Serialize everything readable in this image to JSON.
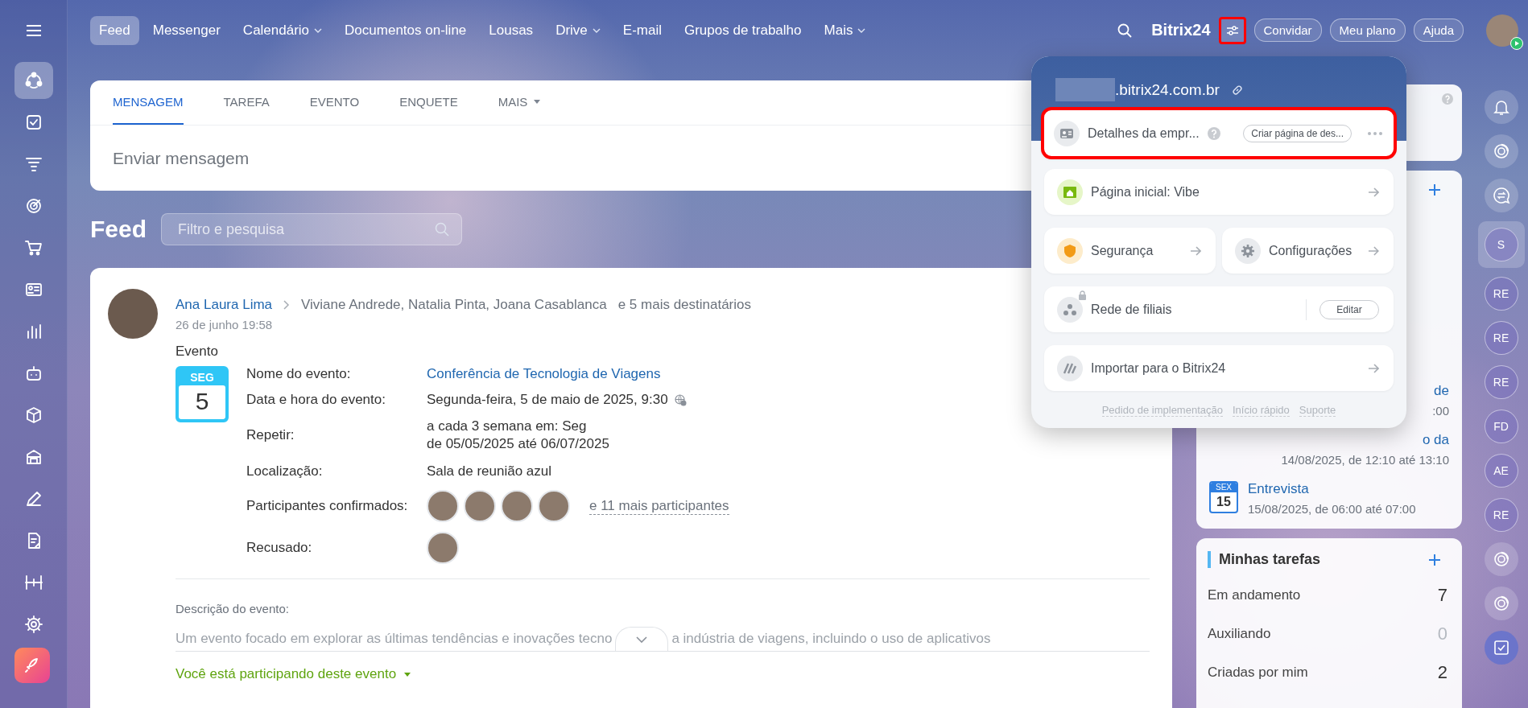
{
  "sidebar": {
    "items": [
      {
        "selected": true
      },
      {
        "selected": false
      },
      {
        "selected": false
      },
      {
        "selected": false
      },
      {
        "selected": false
      },
      {
        "selected": false
      },
      {
        "selected": false
      },
      {
        "selected": false
      },
      {
        "selected": false
      },
      {
        "selected": false
      },
      {
        "selected": false
      },
      {
        "selected": false
      },
      {
        "selected": false
      },
      {
        "selected": false
      },
      {
        "selected": false
      }
    ]
  },
  "topbar": {
    "nav": [
      {
        "label": "Feed",
        "selected": true,
        "dropdown": false
      },
      {
        "label": "Messenger",
        "selected": false,
        "dropdown": false
      },
      {
        "label": "Calendário",
        "selected": false,
        "dropdown": true
      },
      {
        "label": "Documentos on-line",
        "selected": false,
        "dropdown": false
      },
      {
        "label": "Lousas",
        "selected": false,
        "dropdown": false
      },
      {
        "label": "Drive",
        "selected": false,
        "dropdown": true
      },
      {
        "label": "E-mail",
        "selected": false,
        "dropdown": false
      },
      {
        "label": "Grupos de trabalho",
        "selected": false,
        "dropdown": false
      },
      {
        "label": "Mais",
        "selected": false,
        "dropdown": true
      }
    ],
    "logo": "Bitrix24",
    "settings_highlighted": true,
    "buttons": [
      "Convidar",
      "Meu plano",
      "Ajuda"
    ]
  },
  "composer": {
    "tabs": [
      {
        "label": "MENSAGEM",
        "selected": true,
        "dropdown": false
      },
      {
        "label": "TAREFA",
        "selected": false,
        "dropdown": false
      },
      {
        "label": "EVENTO",
        "selected": false,
        "dropdown": false
      },
      {
        "label": "ENQUETE",
        "selected": false,
        "dropdown": false
      },
      {
        "label": "MAIS",
        "selected": false,
        "dropdown": true
      }
    ],
    "placeholder": "Enviar mensagem"
  },
  "feed": {
    "title": "Feed",
    "filter_placeholder": "Filtro e pesquisa"
  },
  "post": {
    "author": "Ana Laura Lima",
    "recipients": "Viviane Andrede, Natalia Pinta, Joana Casablanca",
    "more_recipients": "e 5 mais destinatários",
    "date": "26 de junho 19:58",
    "type": "Evento",
    "calendar": {
      "weekday": "SEG",
      "day": "5"
    },
    "fields": [
      {
        "kind": "link",
        "label": "Nome do evento:",
        "lines": [
          "Conferência de Tecnologia de Viagens"
        ]
      },
      {
        "kind": "time",
        "label": "Data e hora do evento:",
        "lines": [
          "Segunda-feira, 5 de maio de 2025, 9:30"
        ]
      },
      {
        "kind": "text",
        "label": "Repetir:",
        "lines": [
          "a cada 3 semana em: Seg",
          "de 05/05/2025 até 06/07/2025"
        ]
      },
      {
        "kind": "text",
        "label": "Localização:",
        "lines": [
          "Sala de reunião azul"
        ]
      },
      {
        "kind": "people",
        "label": "Participantes confirmados:",
        "avatars": [
          {
            "kind": "photo"
          },
          {
            "kind": "photo"
          },
          {
            "kind": "photo"
          },
          {
            "kind": "photo"
          }
        ],
        "more": "e 11 mais participantes"
      },
      {
        "kind": "people",
        "label": "Recusado:",
        "avatars": [
          {
            "kind": "photo"
          }
        ]
      }
    ],
    "description_label": "Descrição do evento:",
    "description_parts": [
      "Um evento focado em explorar as últimas tendências e inovações tecno",
      "a indústria de viagens, incluindo o uso de aplicativos"
    ],
    "participation": "Você está participando deste evento"
  },
  "popup": {
    "domain": ".bitrix24.com.br",
    "rows": [
      [
        {
          "kind": "company",
          "label": "Detalhes da empr...",
          "help": true,
          "locked": false,
          "button": "Criar página de des...",
          "arrow": false,
          "menu": true,
          "highlighted": true
        }
      ],
      [
        {
          "kind": "home",
          "label": "Página inicial: Vibe",
          "help": false,
          "locked": false,
          "arrow": true,
          "menu": false,
          "highlighted": false
        }
      ],
      [
        {
          "kind": "security",
          "label": "Segurança",
          "help": false,
          "locked": false,
          "arrow": true,
          "menu": false,
          "highlighted": false
        },
        {
          "kind": "settings",
          "label": "Configurações",
          "help": false,
          "locked": false,
          "arrow": true,
          "menu": false,
          "highlighted": false
        }
      ],
      [
        {
          "kind": "branches",
          "label": "Rede de filiais",
          "help": false,
          "locked": true,
          "button": "Editar",
          "arrow": false,
          "menu": false,
          "highlighted": false
        }
      ],
      [
        {
          "kind": "import",
          "label": "Importar para o Bitrix24",
          "help": false,
          "locked": false,
          "arrow": true,
          "menu": false,
          "highlighted": false
        }
      ]
    ],
    "footer_links": [
      "Pedido de implementação",
      "Início rápido",
      "Suporte"
    ]
  },
  "calendar_card": {
    "events": [
      {
        "kind": "partial",
        "title": "de",
        "time": ":00"
      },
      {
        "kind": "partial",
        "title": "o da",
        "time": "14/08/2025, de 12:10 até 13:10"
      },
      {
        "kind": "full",
        "title": "Entrevista",
        "time": "15/08/2025, de 06:00 até 07:00",
        "weekday": "SEX",
        "day": "15"
      }
    ]
  },
  "tasks": {
    "title": "Minhas tarefas",
    "rows": [
      {
        "label": "Em andamento",
        "count": "7",
        "muted": false
      },
      {
        "label": "Auxiliando",
        "count": "0",
        "muted": true
      },
      {
        "label": "Criadas por mim",
        "count": "2",
        "muted": false
      }
    ]
  },
  "rail": {
    "items": [
      {
        "kind": "bell",
        "selected": false
      },
      {
        "kind": "copilot",
        "selected": false
      },
      {
        "kind": "chat",
        "selected": false
      },
      {
        "kind": "avatar",
        "initials": "S",
        "selected": true
      },
      {
        "kind": "avatar",
        "initials": "RE",
        "selected": false
      },
      {
        "kind": "avatar",
        "initials": "RE",
        "selected": false
      },
      {
        "kind": "avatar",
        "initials": "RE",
        "selected": false
      },
      {
        "kind": "avatar",
        "initials": "FD",
        "selected": false
      },
      {
        "kind": "avatar",
        "initials": "AE",
        "selected": false
      },
      {
        "kind": "avatar",
        "initials": "RE",
        "selected": false
      },
      {
        "kind": "copilot",
        "selected": false
      },
      {
        "kind": "copilot",
        "selected": false
      },
      {
        "kind": "tasks",
        "selected": false
      }
    ]
  }
}
